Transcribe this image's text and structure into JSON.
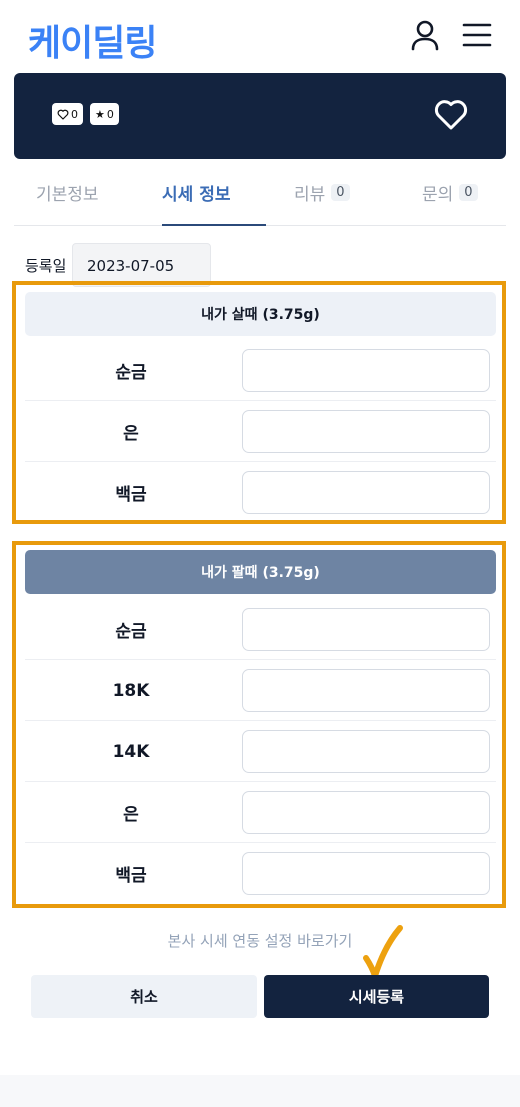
{
  "header": {
    "logo_text": "케이딜링",
    "user_icon": "user-icon",
    "menu_icon": "hamburger-menu-icon"
  },
  "banner": {
    "like_count": "0",
    "star_count": "0",
    "heart_icon": "heart-outline-icon"
  },
  "tabs": [
    {
      "label": "기본정보",
      "count": null,
      "active": false
    },
    {
      "label": "시세 정보",
      "count": null,
      "active": true
    },
    {
      "label": "리뷰",
      "count": "0",
      "active": false
    },
    {
      "label": "문의",
      "count": "0",
      "active": false
    }
  ],
  "registration": {
    "label": "등록일",
    "date": "2023-07-05"
  },
  "buy_section": {
    "title": "내가 살때 (3.75g)",
    "rows": [
      {
        "label": "순금",
        "value": ""
      },
      {
        "label": "은",
        "value": ""
      },
      {
        "label": "백금",
        "value": ""
      }
    ]
  },
  "sell_section": {
    "title": "내가 팔때 (3.75g)",
    "rows": [
      {
        "label": "순금",
        "value": ""
      },
      {
        "label": "18K",
        "value": ""
      },
      {
        "label": "14K",
        "value": ""
      },
      {
        "label": "은",
        "value": ""
      },
      {
        "label": "백금",
        "value": ""
      }
    ]
  },
  "sync_link": "본사 시세 연동 설정 바로가기",
  "actions": {
    "cancel_label": "취소",
    "submit_label": "시세등록"
  },
  "colors": {
    "brand_blue": "#3b82f6",
    "navy": "#13233f",
    "highlight_orange": "#e89a0c",
    "sell_header": "#6e84a3"
  }
}
